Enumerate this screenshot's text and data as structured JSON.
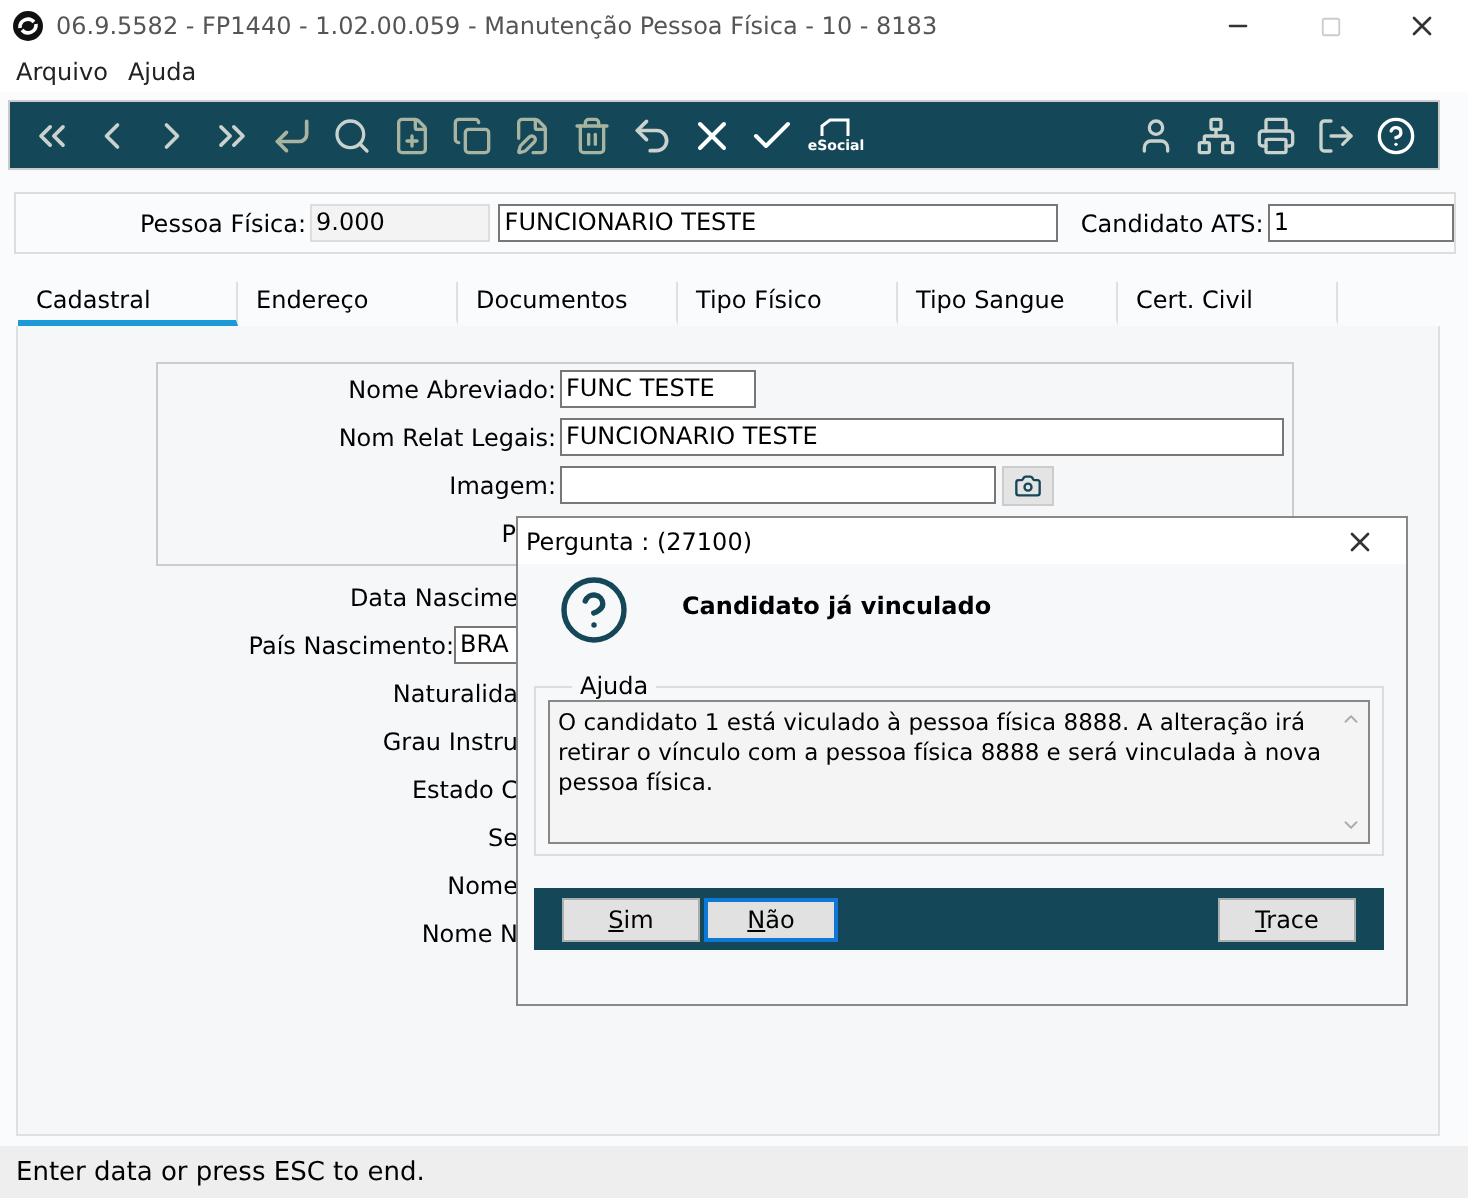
{
  "window": {
    "title": "06.9.5582 - FP1440 - 1.02.00.059 - Manutenção Pessoa Física - 10 - 8183"
  },
  "menu": [
    "Arquivo",
    "Ajuda"
  ],
  "toolbar": {
    "left": [
      {
        "kind": "first"
      },
      {
        "kind": "prev"
      },
      {
        "kind": "next"
      },
      {
        "kind": "last"
      },
      {
        "kind": "goto"
      },
      {
        "kind": "search"
      },
      {
        "kind": "new"
      },
      {
        "kind": "copy"
      },
      {
        "kind": "edit"
      },
      {
        "kind": "delete"
      },
      {
        "kind": "undo"
      },
      {
        "kind": "cancel"
      },
      {
        "kind": "save"
      },
      {
        "kind": "esocial",
        "label": "eSocial"
      }
    ],
    "right": [
      {
        "kind": "user"
      },
      {
        "kind": "tree"
      },
      {
        "kind": "print"
      },
      {
        "kind": "exit"
      },
      {
        "kind": "help"
      }
    ]
  },
  "header": {
    "pessoa_label": "Pessoa Física:",
    "pessoa_code": "9.000",
    "pessoa_name": "FUNCIONARIO TESTE",
    "ats_label": "Candidato ATS:",
    "ats_value": "1"
  },
  "tabs": [
    {
      "label": "Cadastral",
      "selected": true
    },
    {
      "label": "Endereço",
      "selected": false
    },
    {
      "label": "Documentos",
      "selected": false
    },
    {
      "label": "Tipo Físico",
      "selected": false
    },
    {
      "label": "Tipo Sangue",
      "selected": false
    },
    {
      "label": "Cert. Civil",
      "selected": false
    }
  ],
  "group_rows": [
    {
      "kind": "field",
      "label": "Nome Abreviado:",
      "value": "FUNC TESTE"
    },
    {
      "kind": "field",
      "label": "Nom Relat Legais:",
      "value": "FUNCIONARIO TESTE"
    },
    {
      "kind": "image",
      "label": "Imagem:",
      "value": ""
    },
    {
      "kind": "covered",
      "label": "P"
    }
  ],
  "rows": [
    {
      "kind": "covered",
      "label": "Data Nascime"
    },
    {
      "kind": "field",
      "label": "País Nascimento:",
      "value": "BRA"
    },
    {
      "kind": "covered",
      "label": "Naturalida"
    },
    {
      "kind": "covered",
      "label": "Grau Instru"
    },
    {
      "kind": "covered",
      "label": "Estado C"
    },
    {
      "kind": "covered",
      "label": "Se"
    },
    {
      "kind": "covered",
      "label": "Nome"
    },
    {
      "kind": "covered",
      "label": "Nome N"
    }
  ],
  "dialog": {
    "title": "Pergunta : (27100)",
    "heading": "Candidato já vinculado",
    "group": "Ajuda",
    "message": "O candidato 1 está viculado à pessoa física 8888. A alteração irá retirar o vínculo com a pessoa física 8888 e será vinculada à nova pessoa física.",
    "buttons": [
      {
        "label": "Sim",
        "focused": false
      },
      {
        "label": "Não",
        "focused": true
      },
      {
        "label": "Trace",
        "focused": false
      }
    ]
  },
  "status_bar": "Enter data or press ESC to end."
}
